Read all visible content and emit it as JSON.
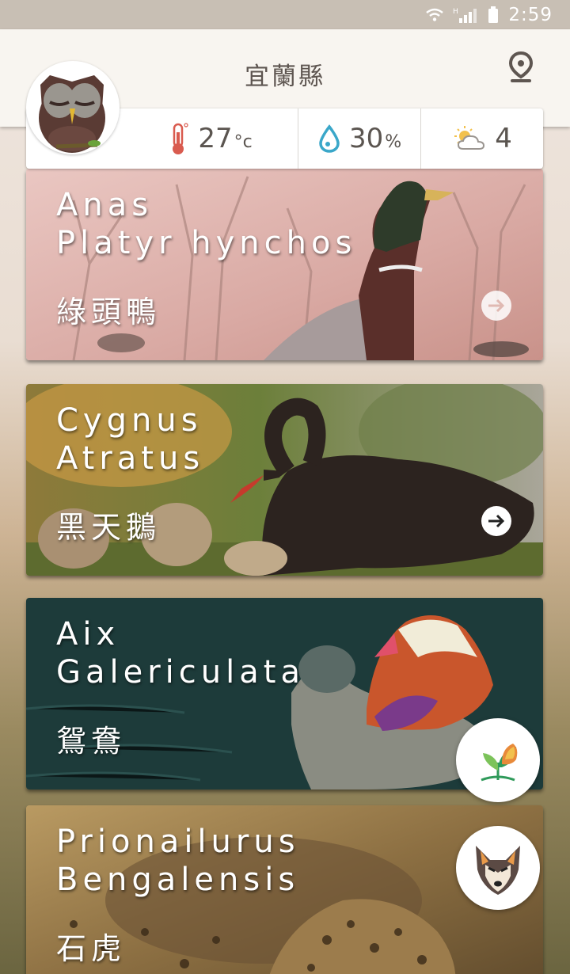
{
  "status_bar": {
    "time": "2:59",
    "network": "H",
    "icons": [
      "wifi-icon",
      "signal-icon",
      "battery-icon"
    ]
  },
  "header": {
    "title": "宜蘭縣",
    "location_icon": "location-pin-icon"
  },
  "weather": {
    "temperature": "27",
    "temperature_unit": "°c",
    "humidity": "30",
    "humidity_unit": "%",
    "uv": "4"
  },
  "cards": [
    {
      "latin": "Anas\nPlatyr hynchos",
      "chinese": "綠頭鴨",
      "arrow": "arrow-right-icon"
    },
    {
      "latin": "Cygnus\nAtratus",
      "chinese": "黑天鵝",
      "arrow": "arrow-right-icon"
    },
    {
      "latin": "Aix\nGalericulata",
      "chinese": "鴛鴦"
    },
    {
      "latin": "Prionailurus\nBengalensis",
      "chinese": "石虎"
    }
  ],
  "fabs": [
    "plant-icon",
    "wolf-icon"
  ],
  "colors": {
    "header_bg": "#f8f5f0",
    "text": "#5e5651",
    "status_bar": "#c8bfb4"
  }
}
